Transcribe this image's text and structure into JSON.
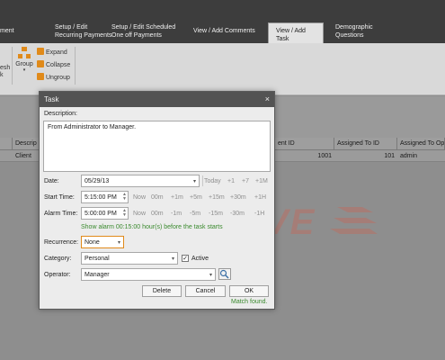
{
  "tabs": [
    {
      "label": "ment"
    },
    {
      "label": "Setup / Edit Recurring Payments"
    },
    {
      "label": "Setup / Edit Scheduled One off Payments"
    },
    {
      "label": "View / Add Comments"
    },
    {
      "label": "View / Add Task"
    },
    {
      "label": "Demographic Questions"
    }
  ],
  "ribbon": {
    "refresh": "esh\nk",
    "group": "Group",
    "expand": "Expand",
    "collapse": "Collapse",
    "ungroup": "Ungroup"
  },
  "grid": {
    "headers": [
      "",
      "Descrip",
      "ent ID",
      "Assigned To ID",
      "Assigned To Op"
    ],
    "row": [
      "Client",
      "1001",
      "101",
      "admin"
    ]
  },
  "dialog": {
    "title": "Task",
    "description_label": "Description:",
    "description": "From Administrator to Manager.",
    "date_label": "Date:",
    "date_value": "05/29/13",
    "date_quick": [
      "Today",
      "+1",
      "+7",
      "+1M"
    ],
    "start_label": "Start Time:",
    "start_value": "5:15:00 PM",
    "start_quick": [
      "Now",
      "00m",
      "+1m",
      "+5m",
      "+15m",
      "+30m",
      "+1H"
    ],
    "alarm_label": "Alarm Time:",
    "alarm_value": "5:00:00 PM",
    "alarm_quick": [
      "Now",
      "00m",
      "-1m",
      "-5m",
      "-15m",
      "-30m",
      "-1H"
    ],
    "alarm_hint": "Show alarm 00:15:00 hour(s) before the task starts",
    "recurrence_label": "Recurrence:",
    "recurrence_value": "None",
    "category_label": "Category:",
    "category_value": "Personal",
    "active_label": "Active",
    "active_checked": true,
    "operator_label": "Operator:",
    "operator_value": "Manager",
    "delete_label": "Delete",
    "cancel_label": "Cancel",
    "ok_label": "OK",
    "match_text": "Match found."
  },
  "watermark": "HIDRIVE",
  "colors": {
    "accent_orange": "#e08a1a",
    "hint_green": "#3a8a2e",
    "watermark_red": "#e0553e"
  }
}
